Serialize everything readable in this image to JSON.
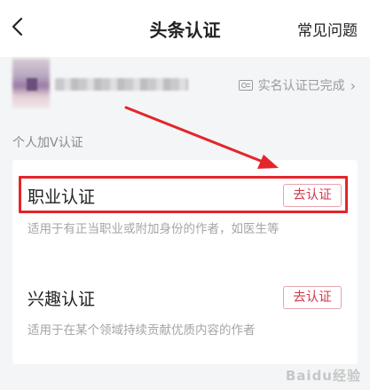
{
  "header": {
    "back_icon": "chevron-left-icon",
    "title": "头条认证",
    "faq_label": "常见问题"
  },
  "user": {
    "verified_status": "实名认证已完成",
    "verified_icon": "id-card-icon",
    "chevron": "›"
  },
  "section": {
    "label": "个人加V认证"
  },
  "items": [
    {
      "title": "职业认证",
      "description": "适用于有正当职业或附加身份的作者，如医生等",
      "button_label": "去认证"
    },
    {
      "title": "兴趣认证",
      "description": "适用于在某个领域持续贡献优质内容的作者",
      "button_label": "去认证"
    }
  ],
  "annotation": {
    "color": "#e4252b"
  },
  "watermark": {
    "text": "Baidu经验"
  }
}
